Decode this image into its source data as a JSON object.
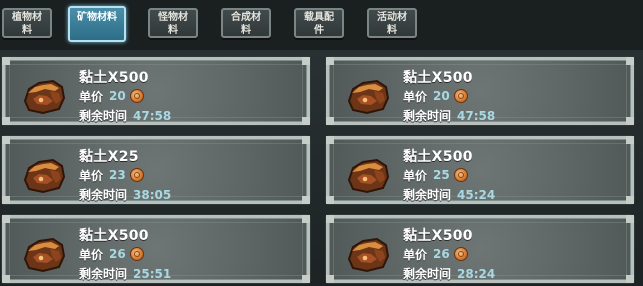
{
  "tabs": [
    {
      "label": "植物材料",
      "active": false
    },
    {
      "label": "矿物材料",
      "active": true
    },
    {
      "label": "怪物材料",
      "active": false
    },
    {
      "label": "合成材料",
      "active": false
    },
    {
      "label": "载具配件",
      "active": false
    },
    {
      "label": "活动材料",
      "active": false
    }
  ],
  "labels": {
    "price": "单价",
    "remaining_time": "剩余时间"
  },
  "listings": [
    {
      "name": "黏土X500",
      "price": "20",
      "time": "47:58",
      "icon": "clay-icon"
    },
    {
      "name": "黏土X500",
      "price": "20",
      "time": "47:58",
      "icon": "clay-icon"
    },
    {
      "name": "黏土X25",
      "price": "23",
      "time": "38:05",
      "icon": "clay-icon"
    },
    {
      "name": "黏土X500",
      "price": "25",
      "time": "45:24",
      "icon": "clay-icon"
    },
    {
      "name": "黏土X500",
      "price": "26",
      "time": "25:51",
      "icon": "clay-icon"
    },
    {
      "name": "黏土X500",
      "price": "26",
      "time": "28:24",
      "icon": "clay-icon"
    }
  ],
  "colors": {
    "accent_tab": "#3f86a2",
    "value_text": "#a9d8e2",
    "coin": "#d77d32"
  }
}
